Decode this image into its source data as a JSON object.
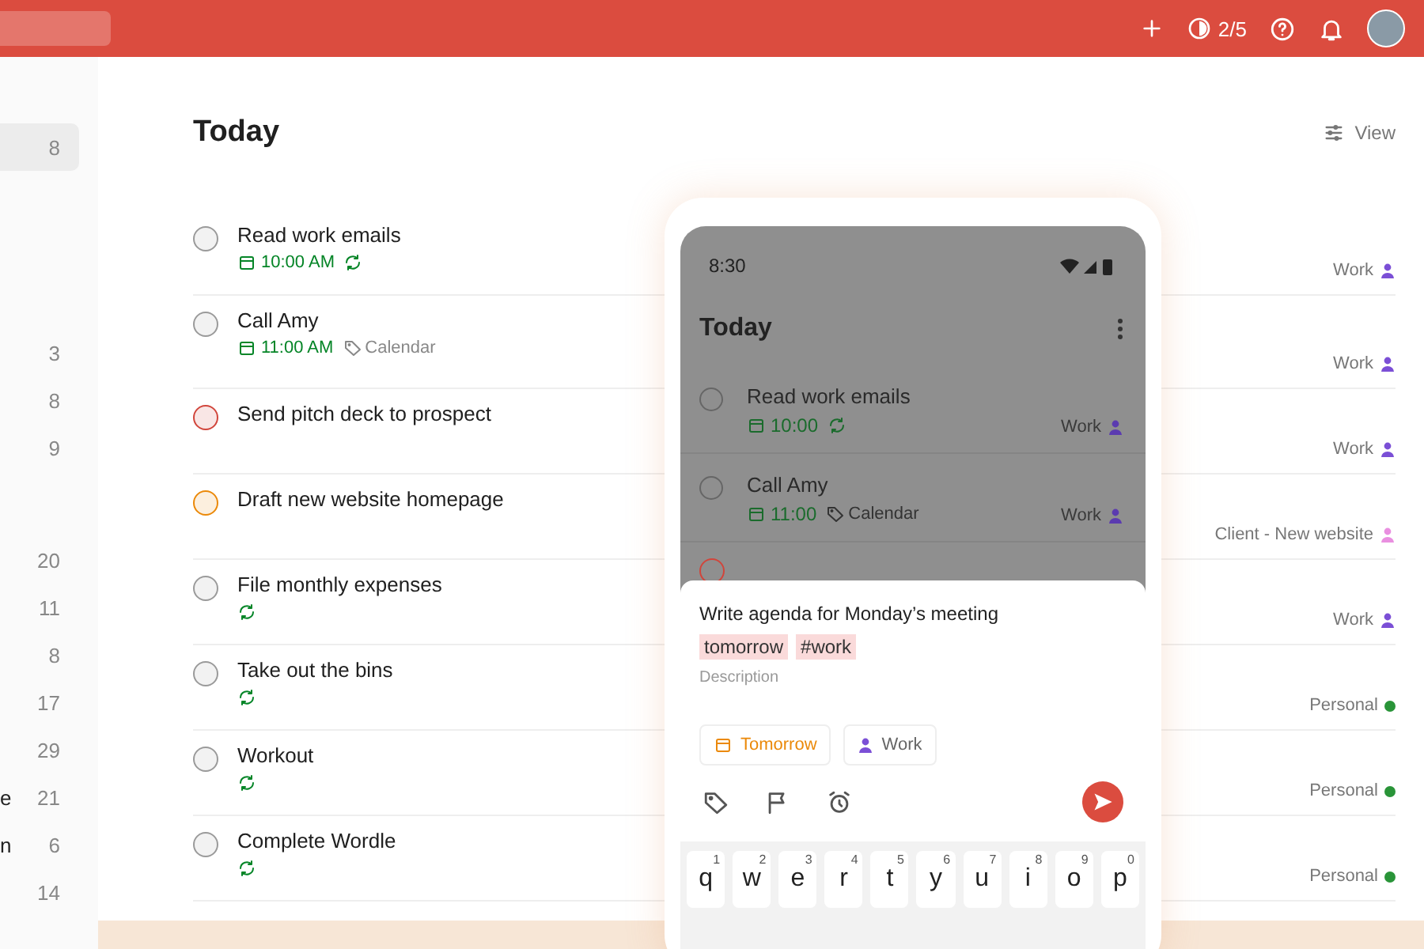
{
  "topbar": {
    "karma": "2/5"
  },
  "sidebar": {
    "groups": [
      {
        "items": [
          {
            "count": "8",
            "selected": true
          }
        ]
      },
      {
        "items": [
          {
            "count": "3",
            "selected": false
          },
          {
            "count": "8",
            "selected": false
          },
          {
            "count": "9",
            "selected": false
          }
        ]
      },
      {
        "items": [
          {
            "count": "20",
            "selected": false
          },
          {
            "count": "11",
            "selected": false
          },
          {
            "count": "8",
            "selected": false
          },
          {
            "count": "17",
            "selected": false
          },
          {
            "count": "29",
            "selected": false
          },
          {
            "label": "e",
            "count": "21",
            "selected": false
          },
          {
            "label": "n",
            "count": "6",
            "selected": false
          },
          {
            "count": "14",
            "selected": false
          }
        ]
      }
    ]
  },
  "main": {
    "title": "Today",
    "view_button": "View"
  },
  "tasks": [
    {
      "title": "Read work emails",
      "color": "#9a9a9a",
      "due": "10:00 AM",
      "recurring": true,
      "project": {
        "kind": "person",
        "name": "Work",
        "color": "#7b4fd6"
      }
    },
    {
      "title": "Call Amy",
      "color": "#9a9a9a",
      "due": "11:00 AM",
      "recurring": false,
      "label": "Calendar",
      "project": {
        "kind": "person",
        "name": "Work",
        "color": "#7b4fd6"
      }
    },
    {
      "title": "Send pitch deck to prospect",
      "color": "#d1453b",
      "recurring": false,
      "project": {
        "kind": "person",
        "name": "Work",
        "color": "#7b4fd6"
      }
    },
    {
      "title": "Draft new website homepage",
      "color": "#eb8909",
      "recurring": false,
      "project": {
        "kind": "person",
        "name": "Client - New website",
        "color": "#e98fe0"
      }
    },
    {
      "title": "File monthly expenses",
      "color": "#9a9a9a",
      "recurring": true,
      "project": {
        "kind": "person",
        "name": "Work",
        "color": "#7b4fd6"
      }
    },
    {
      "title": "Take out the bins",
      "color": "#9a9a9a",
      "recurring": true,
      "project": {
        "kind": "dot",
        "name": "Personal",
        "color": "#299438"
      }
    },
    {
      "title": "Workout",
      "color": "#9a9a9a",
      "recurring": true,
      "project": {
        "kind": "dot",
        "name": "Personal",
        "color": "#299438"
      }
    },
    {
      "title": "Complete Wordle",
      "color": "#9a9a9a",
      "recurring": true,
      "project": {
        "kind": "dot",
        "name": "Personal",
        "color": "#299438"
      }
    }
  ],
  "phone": {
    "time": "8:30",
    "title": "Today",
    "tasks": [
      {
        "title": "Read work emails",
        "color": "#666666",
        "due": "10:00",
        "recurring": true,
        "project": {
          "name": "Work",
          "color": "#5b3bb0"
        }
      },
      {
        "title": "Call Amy",
        "color": "#666666",
        "due": "11:00",
        "recurring": false,
        "label": "Calendar",
        "project": {
          "name": "Work",
          "color": "#5b3bb0"
        }
      }
    ],
    "peek_task": {
      "color": "#d1453b"
    },
    "composer": {
      "text": "Write agenda for Monday’s meeting",
      "tokens": [
        "tomorrow",
        "#work"
      ],
      "description_placeholder": "Description",
      "chips": [
        {
          "kind": "date",
          "label": "Tomorrow"
        },
        {
          "kind": "project",
          "label": "Work",
          "color": "#7b4fd6"
        }
      ]
    },
    "keyboard": [
      {
        "letter": "q",
        "digit": "1"
      },
      {
        "letter": "w",
        "digit": "2"
      },
      {
        "letter": "e",
        "digit": "3"
      },
      {
        "letter": "r",
        "digit": "4"
      },
      {
        "letter": "t",
        "digit": "5"
      },
      {
        "letter": "y",
        "digit": "6"
      },
      {
        "letter": "u",
        "digit": "7"
      },
      {
        "letter": "i",
        "digit": "8"
      },
      {
        "letter": "o",
        "digit": "9"
      },
      {
        "letter": "p",
        "digit": "0"
      }
    ]
  }
}
